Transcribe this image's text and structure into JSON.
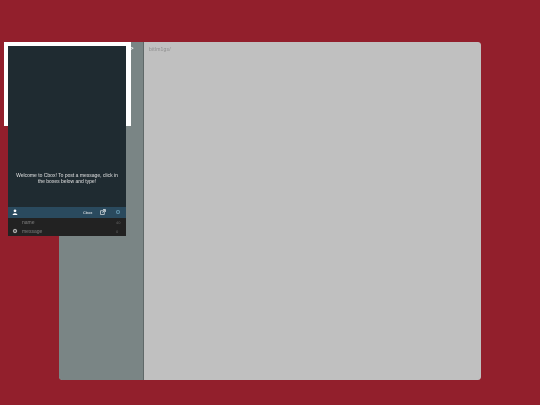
{
  "main": {
    "url": "bitlm1gs/"
  },
  "cbox": {
    "welcome": "Welcome to Cbox! To post a message, click in the boxes below and type!",
    "toolbar": {
      "link_label": "Cbox"
    },
    "form": {
      "name_placeholder": "name",
      "message_placeholder": "message",
      "name_count": "40",
      "message_count": "0"
    }
  },
  "icons": {
    "user": "user-icon",
    "popout": "popout-icon",
    "status": "status-dot-icon",
    "settings": "gear-icon",
    "chevron": "chevron-right-icon"
  },
  "colors": {
    "background": "#921f2c",
    "panel": "#c0c0c0",
    "sidebar": "#7a8585",
    "cbox_bg": "#1f2b31",
    "toolbar": "#2a4a5e"
  }
}
